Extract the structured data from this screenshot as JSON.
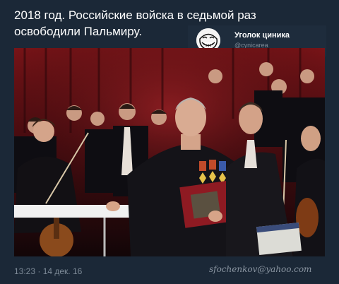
{
  "tweet": {
    "text": "2018 год. Российские войска в седьмой раз освободили Пальмиру.",
    "timestamp": "13:23 · 14 дек. 16"
  },
  "profile_card": {
    "name": "Уголок циника",
    "handle": "@cynicarea",
    "avatar_icon": "trollface-avatar"
  },
  "photo": {
    "description_icon": "orchestra-conductor-photo"
  },
  "watermark": {
    "text": "sfochenkov@yahoo.com"
  },
  "colors": {
    "background": "#1b2837",
    "text": "#ffffff",
    "muted": "#7d8a97"
  }
}
